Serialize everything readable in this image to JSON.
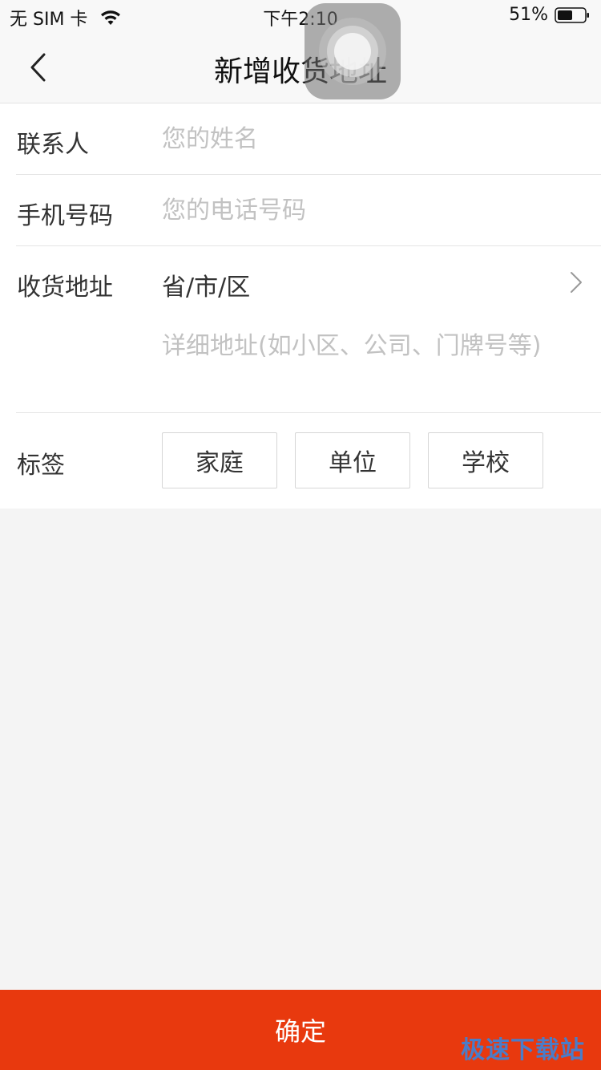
{
  "status_bar": {
    "carrier": "无 SIM 卡",
    "time": "下午2:10",
    "battery": "51%"
  },
  "nav": {
    "title": "新增收货地址"
  },
  "form": {
    "contact": {
      "label": "联系人",
      "placeholder": "您的姓名"
    },
    "phone": {
      "label": "手机号码",
      "placeholder": "您的电话号码"
    },
    "address": {
      "label": "收货地址",
      "region": "省/市/区",
      "detail_placeholder": "详细地址(如小区、公司、门牌号等)"
    },
    "tags": {
      "label": "标签",
      "options": [
        "家庭",
        "单位",
        "学校"
      ]
    }
  },
  "confirm": {
    "label": "确定",
    "color": "#e8390e"
  },
  "watermark": "极速下载站"
}
